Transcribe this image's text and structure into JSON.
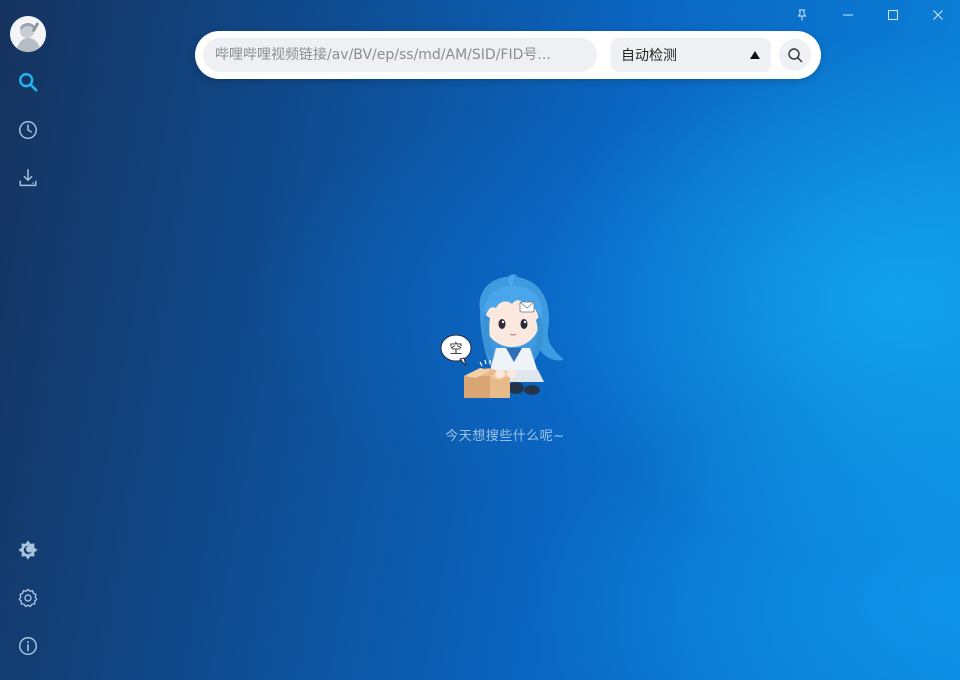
{
  "window": {
    "controls": {
      "pin_icon": "pin-icon",
      "minimize_icon": "minimize-icon",
      "maximize_icon": "maximize-icon",
      "close_icon": "close-icon"
    }
  },
  "sidebar": {
    "top_items": [
      {
        "icon": "search-icon",
        "color": "#25b6f0",
        "active": true
      },
      {
        "icon": "history-icon",
        "color": "#a9c2de"
      },
      {
        "icon": "download-icon",
        "color": "#a9c2de"
      }
    ],
    "bottom_items": [
      {
        "icon": "theme-icon",
        "color": "#a9c2de"
      },
      {
        "icon": "settings-icon",
        "color": "#a9c2de"
      },
      {
        "icon": "info-icon",
        "color": "#a9c2de"
      }
    ]
  },
  "search": {
    "placeholder": "哔哩哔哩视频链接/av/BV/ep/ss/md/AM/SID/FID号...",
    "mode_label": "自动检测"
  },
  "empty_state": {
    "bubble_label": "空",
    "message": "今天想搜些什么呢~"
  }
}
